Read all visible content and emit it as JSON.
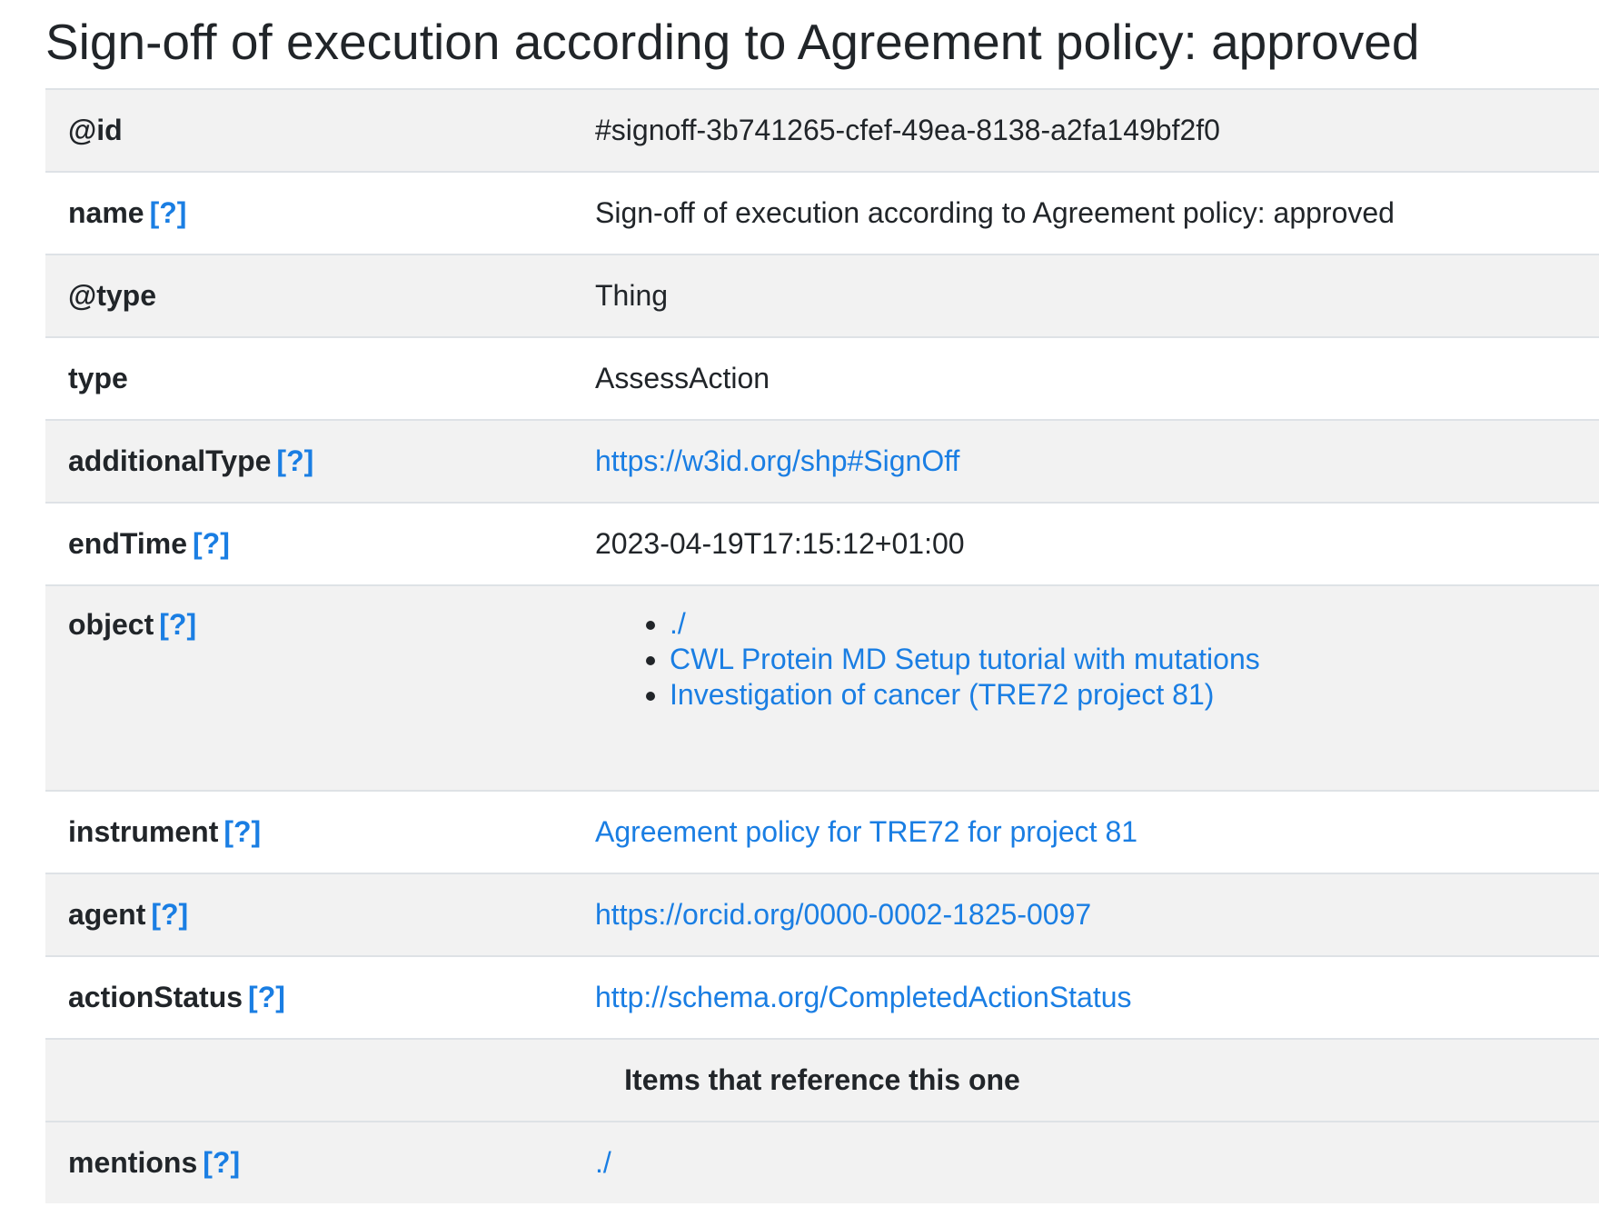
{
  "page_title": "Sign-off of execution according to Agreement policy: approved",
  "help_label": "[?]",
  "rows": [
    {
      "key": "@id",
      "value": "#signoff-3b741265-cfef-49ea-8138-a2fa149bf2f0"
    },
    {
      "key": "name",
      "value": "Sign-off of execution according to Agreement policy: approved"
    },
    {
      "key": "@type",
      "value": "Thing"
    },
    {
      "key": "type",
      "value": "AssessAction"
    },
    {
      "key": "additionalType",
      "value": "https://w3id.org/shp#SignOff"
    },
    {
      "key": "endTime",
      "value": "2023-04-19T17:15:12+01:00"
    },
    {
      "key": "object",
      "values": [
        "./",
        "CWL Protein MD Setup tutorial with mutations",
        "Investigation of cancer (TRE72 project 81)"
      ]
    },
    {
      "key": "instrument",
      "value": "Agreement policy for TRE72 for project 81"
    },
    {
      "key": "agent",
      "value": "https://orcid.org/0000-0002-1825-0097"
    },
    {
      "key": "actionStatus",
      "value": "http://schema.org/CompletedActionStatus"
    }
  ],
  "section_heading": "Items that reference this one",
  "references": [
    {
      "key": "mentions",
      "value": "./"
    }
  ],
  "colors": {
    "link": "#1a7ee3",
    "text": "#212529",
    "stripe": "#f2f2f2",
    "border": "#dee2e6"
  }
}
